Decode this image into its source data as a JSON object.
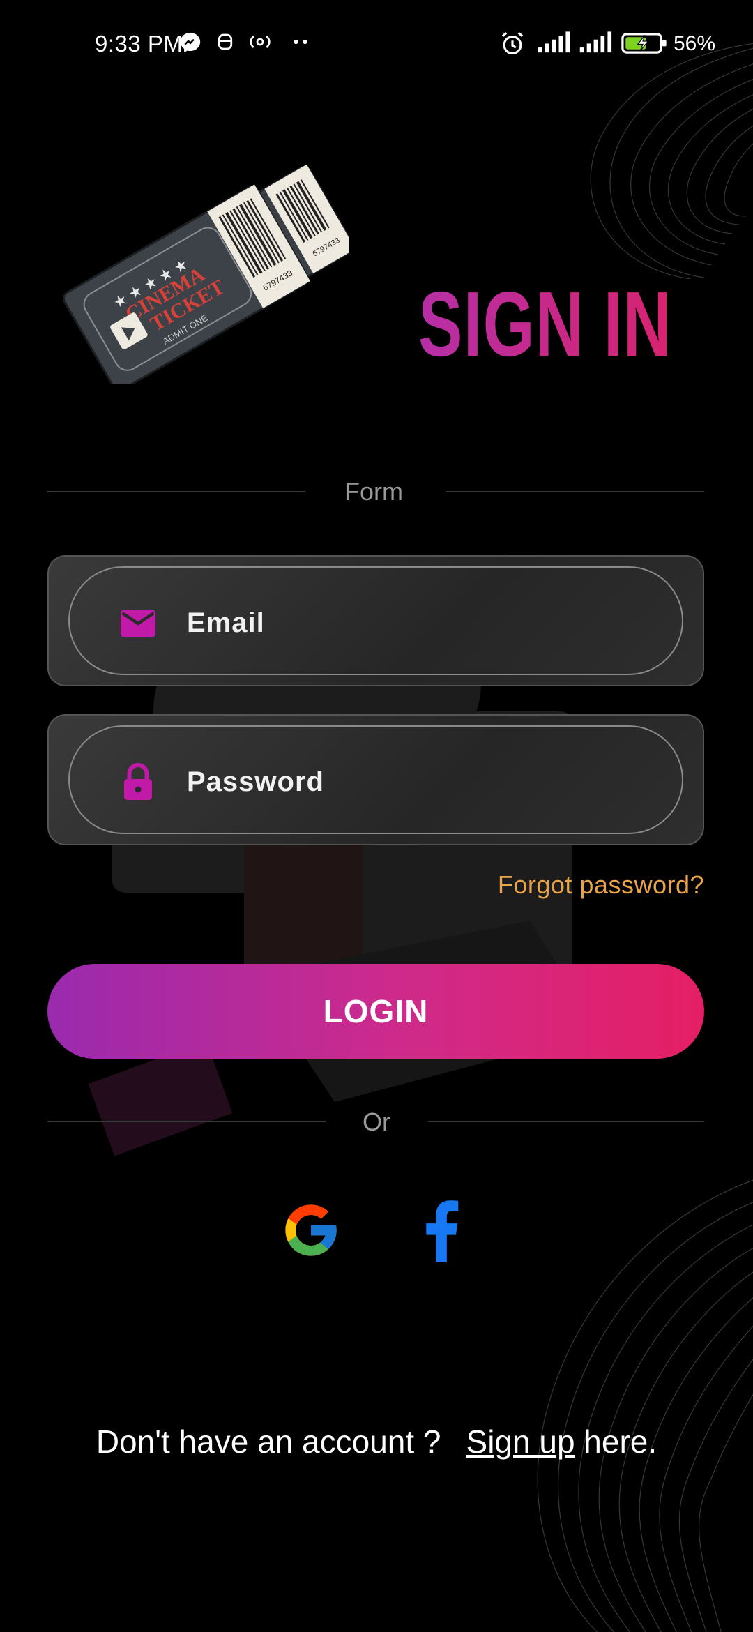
{
  "status_bar": {
    "time": "9:33 PM",
    "battery_percent": "56%",
    "icons": [
      "messenger-icon",
      "notification-icon",
      "hotspot-icon",
      "more-dots-icon",
      "alarm-icon",
      "signal-icon",
      "signal-icon",
      "battery-charging-icon"
    ]
  },
  "header": {
    "title": "SIGN IN",
    "logo": {
      "ticket_text_line1": "CINEMA",
      "ticket_text_line2": "TICKET",
      "admit": "ADMIT ONE",
      "serial": "6797433"
    }
  },
  "form": {
    "divider_label": "Form",
    "email_placeholder": "Email",
    "password_placeholder": "Password",
    "forgot_password": "Forgot password?",
    "login_label": "LOGIN"
  },
  "social": {
    "divider_label": "Or",
    "providers": [
      "google-icon",
      "facebook-icon"
    ]
  },
  "footer": {
    "question": "Don't have an account ?",
    "signup_link": "Sign up",
    "signup_suffix": " here."
  },
  "colors": {
    "accent_purple": "#9a2aae",
    "accent_pink": "#e51f64",
    "icon_magenta": "#c21aa8",
    "link_orange": "#e9a44a",
    "facebook_blue": "#1877f2"
  }
}
